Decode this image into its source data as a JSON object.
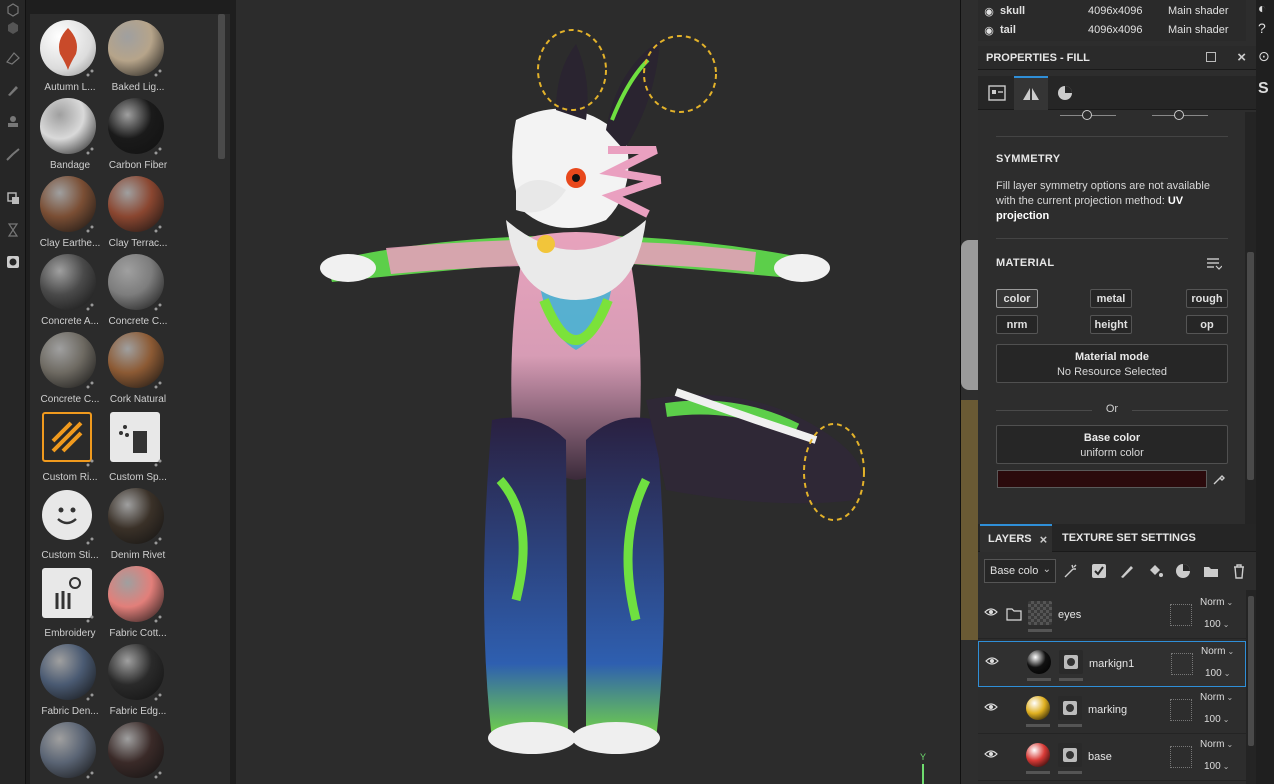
{
  "shelf": {
    "materials": [
      {
        "label": "Autumn L...",
        "color": "#c94a2a",
        "kind": "leaf"
      },
      {
        "label": "Baked Lig...",
        "color": "#b6a48a",
        "kind": "ball"
      },
      {
        "label": "Bandage",
        "color": "#d9d9d9",
        "kind": "ball"
      },
      {
        "label": "Carbon Fiber",
        "color": "#1a1a1a",
        "kind": "ball"
      },
      {
        "label": "Clay Earthe...",
        "color": "#7a4e34",
        "kind": "ball"
      },
      {
        "label": "Clay Terrac...",
        "color": "#8a4630",
        "kind": "ball"
      },
      {
        "label": "Concrete A...",
        "color": "#4a4a4a",
        "kind": "ball"
      },
      {
        "label": "Concrete C...",
        "color": "#7d7d7d",
        "kind": "ball"
      },
      {
        "label": "Concrete C...",
        "color": "#6e6a62",
        "kind": "ball"
      },
      {
        "label": "Cork Natural",
        "color": "#8c5a34",
        "kind": "ball"
      },
      {
        "label": "Custom Ri...",
        "color": "#f09a1e",
        "kind": "smart"
      },
      {
        "label": "Custom Sp...",
        "color": "#e8e8e8",
        "kind": "spray"
      },
      {
        "label": "Custom Sti...",
        "color": "#e8e8e8",
        "kind": "sticker"
      },
      {
        "label": "Denim Rivet",
        "color": "#3a3128",
        "kind": "ball"
      },
      {
        "label": "Embroidery",
        "color": "#e8e8e8",
        "kind": "embroidery"
      },
      {
        "label": "Fabric Cott...",
        "color": "#e27f7a",
        "kind": "ball"
      },
      {
        "label": "Fabric Den...",
        "color": "#4a5a72",
        "kind": "ball"
      },
      {
        "label": "Fabric Edg...",
        "color": "#2a2a2a",
        "kind": "ball"
      },
      {
        "label": "",
        "color": "#5a6474",
        "kind": "ball"
      },
      {
        "label": "",
        "color": "#3a2a28",
        "kind": "ball"
      }
    ]
  },
  "texture_sets": [
    {
      "name": "skull",
      "resolution": "4096x4096",
      "shader": "Main shader"
    },
    {
      "name": "tail",
      "resolution": "4096x4096",
      "shader": "Main shader"
    }
  ],
  "properties": {
    "title": "PROPERTIES - FILL",
    "symmetry": {
      "title": "SYMMETRY",
      "note_prefix": "Fill layer symmetry options are not available with the current projection method: ",
      "note_bold": "UV projection"
    },
    "material": {
      "title": "MATERIAL",
      "channels": [
        "color",
        "metal",
        "rough",
        "nrm",
        "height",
        "op"
      ],
      "mode_title": "Material mode",
      "mode_value": "No Resource Selected",
      "or_label": "Or",
      "base_title": "Base color",
      "base_value": "uniform color",
      "base_swatch": "#2b0a0c"
    }
  },
  "layers": {
    "tab_layers": "LAYERS",
    "tab_texture": "TEXTURE SET SETTINGS",
    "channel_select": "Base colo",
    "items": [
      {
        "name": "eyes",
        "blend": "Norm",
        "opacity": "100",
        "type": "folder"
      },
      {
        "name": "markign1",
        "blend": "Norm",
        "opacity": "100",
        "type": "fill",
        "thumb": "#111111"
      },
      {
        "name": "marking",
        "blend": "Norm",
        "opacity": "100",
        "type": "fill",
        "thumb": "#e0b020"
      },
      {
        "name": "base",
        "blend": "Norm",
        "opacity": "100",
        "type": "fill",
        "thumb": "#d83a36"
      }
    ]
  },
  "viewport": {
    "axis_label": "Y"
  }
}
